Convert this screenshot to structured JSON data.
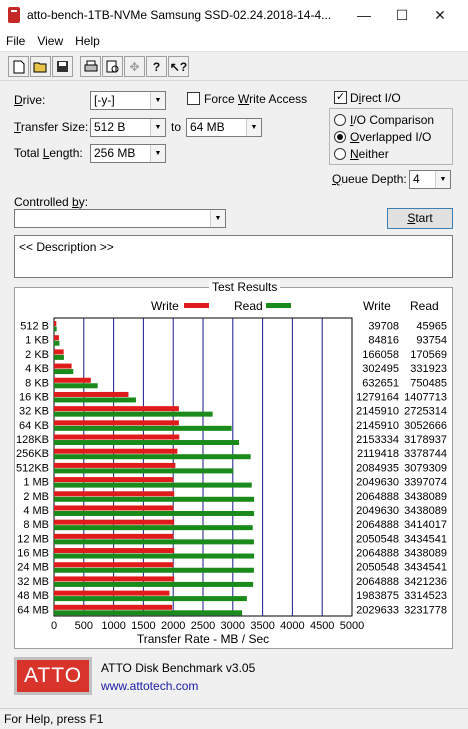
{
  "window": {
    "title": "atto-bench-1TB-NVMe Samsung SSD-02.24.2018-14-4...",
    "minimize_label": "—",
    "maximize_label": "☐",
    "close_label": "✕"
  },
  "menu": {
    "items": [
      "File",
      "View",
      "Help"
    ]
  },
  "toolbar": {
    "icons": [
      "new-icon",
      "open-icon",
      "save-icon",
      "print-icon",
      "print-preview-icon",
      "move-icon",
      "help-icon",
      "context-help-icon"
    ]
  },
  "settings": {
    "drive_label": "Drive:",
    "drive_value": "[-y-]",
    "transfer_size_label": "Transfer Size:",
    "transfer_from": "512 B",
    "to_label": "to",
    "transfer_to": "64 MB",
    "total_length_label": "Total Length:",
    "total_length_value": "256 MB",
    "force_write_label": "Force Write Access",
    "force_write_checked": false,
    "direct_io_label": "Direct I/O",
    "direct_io_checked": true,
    "io_options": [
      {
        "label": "I/O Comparison",
        "selected": false
      },
      {
        "label": "Overlapped I/O",
        "selected": true
      },
      {
        "label": "Neither",
        "selected": false
      }
    ],
    "queue_depth_label": "Queue Depth:",
    "queue_depth_value": "4",
    "controlled_by_label": "Controlled by:",
    "controlled_by_value": "",
    "start_button": "Start",
    "description_text": "<< Description >>"
  },
  "results": {
    "title": "Test Results",
    "write_legend": "Write",
    "read_legend": "Read",
    "write_header": "Write",
    "read_header": "Read"
  },
  "chart_data": {
    "type": "bar",
    "orientation": "horizontal",
    "xlabel": "Transfer Rate - MB / Sec",
    "xlim": [
      0,
      5000
    ],
    "x_ticks": [
      0,
      500,
      1000,
      1500,
      2000,
      2500,
      3000,
      3500,
      4000,
      4500,
      5000
    ],
    "grid": true,
    "legend": "top",
    "colors": {
      "write": "#e01b1b",
      "read": "#1a8a1a"
    },
    "categories": [
      "512 B",
      "1 KB",
      "2 KB",
      "4 KB",
      "8 KB",
      "16 KB",
      "32 KB",
      "64 KB",
      "128KB",
      "256KB",
      "512KB",
      "1 MB",
      "2 MB",
      "4 MB",
      "8 MB",
      "12 MB",
      "16 MB",
      "24 MB",
      "32 MB",
      "48 MB",
      "64 MB"
    ],
    "series": [
      {
        "name": "Write",
        "values": [
          39708,
          84816,
          166058,
          302495,
          632651,
          1279164,
          2145910,
          2145910,
          2153334,
          2119418,
          2084935,
          2049630,
          2064888,
          2049630,
          2064888,
          2050548,
          2064888,
          2050548,
          2064888,
          1983875,
          2029633
        ]
      },
      {
        "name": "Read",
        "values": [
          45965,
          93754,
          170569,
          331923,
          750485,
          1407713,
          2725314,
          3052666,
          3178937,
          3378744,
          3079309,
          3397074,
          3438089,
          3438089,
          3414017,
          3434541,
          3438089,
          3434541,
          3421236,
          3314523,
          3231778
        ]
      }
    ]
  },
  "footer": {
    "logo_text": "ATTO",
    "product_name": "ATTO Disk Benchmark v3.05",
    "website": "www.attotech.com"
  },
  "status": {
    "text": "For Help, press F1"
  }
}
